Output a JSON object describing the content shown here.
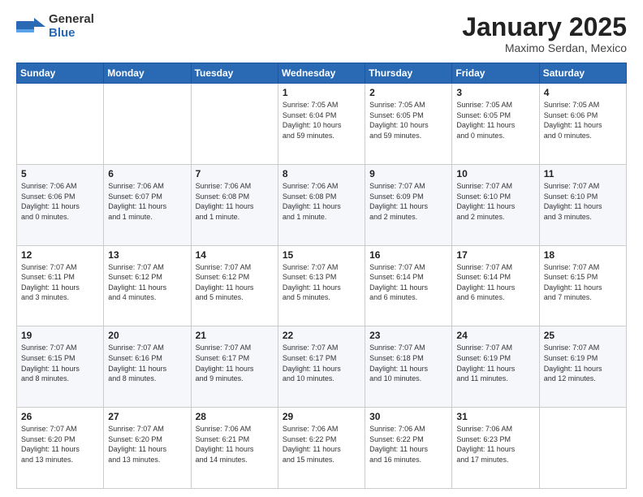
{
  "logo": {
    "general": "General",
    "blue": "Blue"
  },
  "header": {
    "month": "January 2025",
    "location": "Maximo Serdan, Mexico"
  },
  "days_of_week": [
    "Sunday",
    "Monday",
    "Tuesday",
    "Wednesday",
    "Thursday",
    "Friday",
    "Saturday"
  ],
  "weeks": [
    [
      {
        "day": "",
        "info": ""
      },
      {
        "day": "",
        "info": ""
      },
      {
        "day": "",
        "info": ""
      },
      {
        "day": "1",
        "info": "Sunrise: 7:05 AM\nSunset: 6:04 PM\nDaylight: 10 hours\nand 59 minutes."
      },
      {
        "day": "2",
        "info": "Sunrise: 7:05 AM\nSunset: 6:05 PM\nDaylight: 10 hours\nand 59 minutes."
      },
      {
        "day": "3",
        "info": "Sunrise: 7:05 AM\nSunset: 6:05 PM\nDaylight: 11 hours\nand 0 minutes."
      },
      {
        "day": "4",
        "info": "Sunrise: 7:05 AM\nSunset: 6:06 PM\nDaylight: 11 hours\nand 0 minutes."
      }
    ],
    [
      {
        "day": "5",
        "info": "Sunrise: 7:06 AM\nSunset: 6:06 PM\nDaylight: 11 hours\nand 0 minutes."
      },
      {
        "day": "6",
        "info": "Sunrise: 7:06 AM\nSunset: 6:07 PM\nDaylight: 11 hours\nand 1 minute."
      },
      {
        "day": "7",
        "info": "Sunrise: 7:06 AM\nSunset: 6:08 PM\nDaylight: 11 hours\nand 1 minute."
      },
      {
        "day": "8",
        "info": "Sunrise: 7:06 AM\nSunset: 6:08 PM\nDaylight: 11 hours\nand 1 minute."
      },
      {
        "day": "9",
        "info": "Sunrise: 7:07 AM\nSunset: 6:09 PM\nDaylight: 11 hours\nand 2 minutes."
      },
      {
        "day": "10",
        "info": "Sunrise: 7:07 AM\nSunset: 6:10 PM\nDaylight: 11 hours\nand 2 minutes."
      },
      {
        "day": "11",
        "info": "Sunrise: 7:07 AM\nSunset: 6:10 PM\nDaylight: 11 hours\nand 3 minutes."
      }
    ],
    [
      {
        "day": "12",
        "info": "Sunrise: 7:07 AM\nSunset: 6:11 PM\nDaylight: 11 hours\nand 3 minutes."
      },
      {
        "day": "13",
        "info": "Sunrise: 7:07 AM\nSunset: 6:12 PM\nDaylight: 11 hours\nand 4 minutes."
      },
      {
        "day": "14",
        "info": "Sunrise: 7:07 AM\nSunset: 6:12 PM\nDaylight: 11 hours\nand 5 minutes."
      },
      {
        "day": "15",
        "info": "Sunrise: 7:07 AM\nSunset: 6:13 PM\nDaylight: 11 hours\nand 5 minutes."
      },
      {
        "day": "16",
        "info": "Sunrise: 7:07 AM\nSunset: 6:14 PM\nDaylight: 11 hours\nand 6 minutes."
      },
      {
        "day": "17",
        "info": "Sunrise: 7:07 AM\nSunset: 6:14 PM\nDaylight: 11 hours\nand 6 minutes."
      },
      {
        "day": "18",
        "info": "Sunrise: 7:07 AM\nSunset: 6:15 PM\nDaylight: 11 hours\nand 7 minutes."
      }
    ],
    [
      {
        "day": "19",
        "info": "Sunrise: 7:07 AM\nSunset: 6:15 PM\nDaylight: 11 hours\nand 8 minutes."
      },
      {
        "day": "20",
        "info": "Sunrise: 7:07 AM\nSunset: 6:16 PM\nDaylight: 11 hours\nand 8 minutes."
      },
      {
        "day": "21",
        "info": "Sunrise: 7:07 AM\nSunset: 6:17 PM\nDaylight: 11 hours\nand 9 minutes."
      },
      {
        "day": "22",
        "info": "Sunrise: 7:07 AM\nSunset: 6:17 PM\nDaylight: 11 hours\nand 10 minutes."
      },
      {
        "day": "23",
        "info": "Sunrise: 7:07 AM\nSunset: 6:18 PM\nDaylight: 11 hours\nand 10 minutes."
      },
      {
        "day": "24",
        "info": "Sunrise: 7:07 AM\nSunset: 6:19 PM\nDaylight: 11 hours\nand 11 minutes."
      },
      {
        "day": "25",
        "info": "Sunrise: 7:07 AM\nSunset: 6:19 PM\nDaylight: 11 hours\nand 12 minutes."
      }
    ],
    [
      {
        "day": "26",
        "info": "Sunrise: 7:07 AM\nSunset: 6:20 PM\nDaylight: 11 hours\nand 13 minutes."
      },
      {
        "day": "27",
        "info": "Sunrise: 7:07 AM\nSunset: 6:20 PM\nDaylight: 11 hours\nand 13 minutes."
      },
      {
        "day": "28",
        "info": "Sunrise: 7:06 AM\nSunset: 6:21 PM\nDaylight: 11 hours\nand 14 minutes."
      },
      {
        "day": "29",
        "info": "Sunrise: 7:06 AM\nSunset: 6:22 PM\nDaylight: 11 hours\nand 15 minutes."
      },
      {
        "day": "30",
        "info": "Sunrise: 7:06 AM\nSunset: 6:22 PM\nDaylight: 11 hours\nand 16 minutes."
      },
      {
        "day": "31",
        "info": "Sunrise: 7:06 AM\nSunset: 6:23 PM\nDaylight: 11 hours\nand 17 minutes."
      },
      {
        "day": "",
        "info": ""
      }
    ]
  ]
}
